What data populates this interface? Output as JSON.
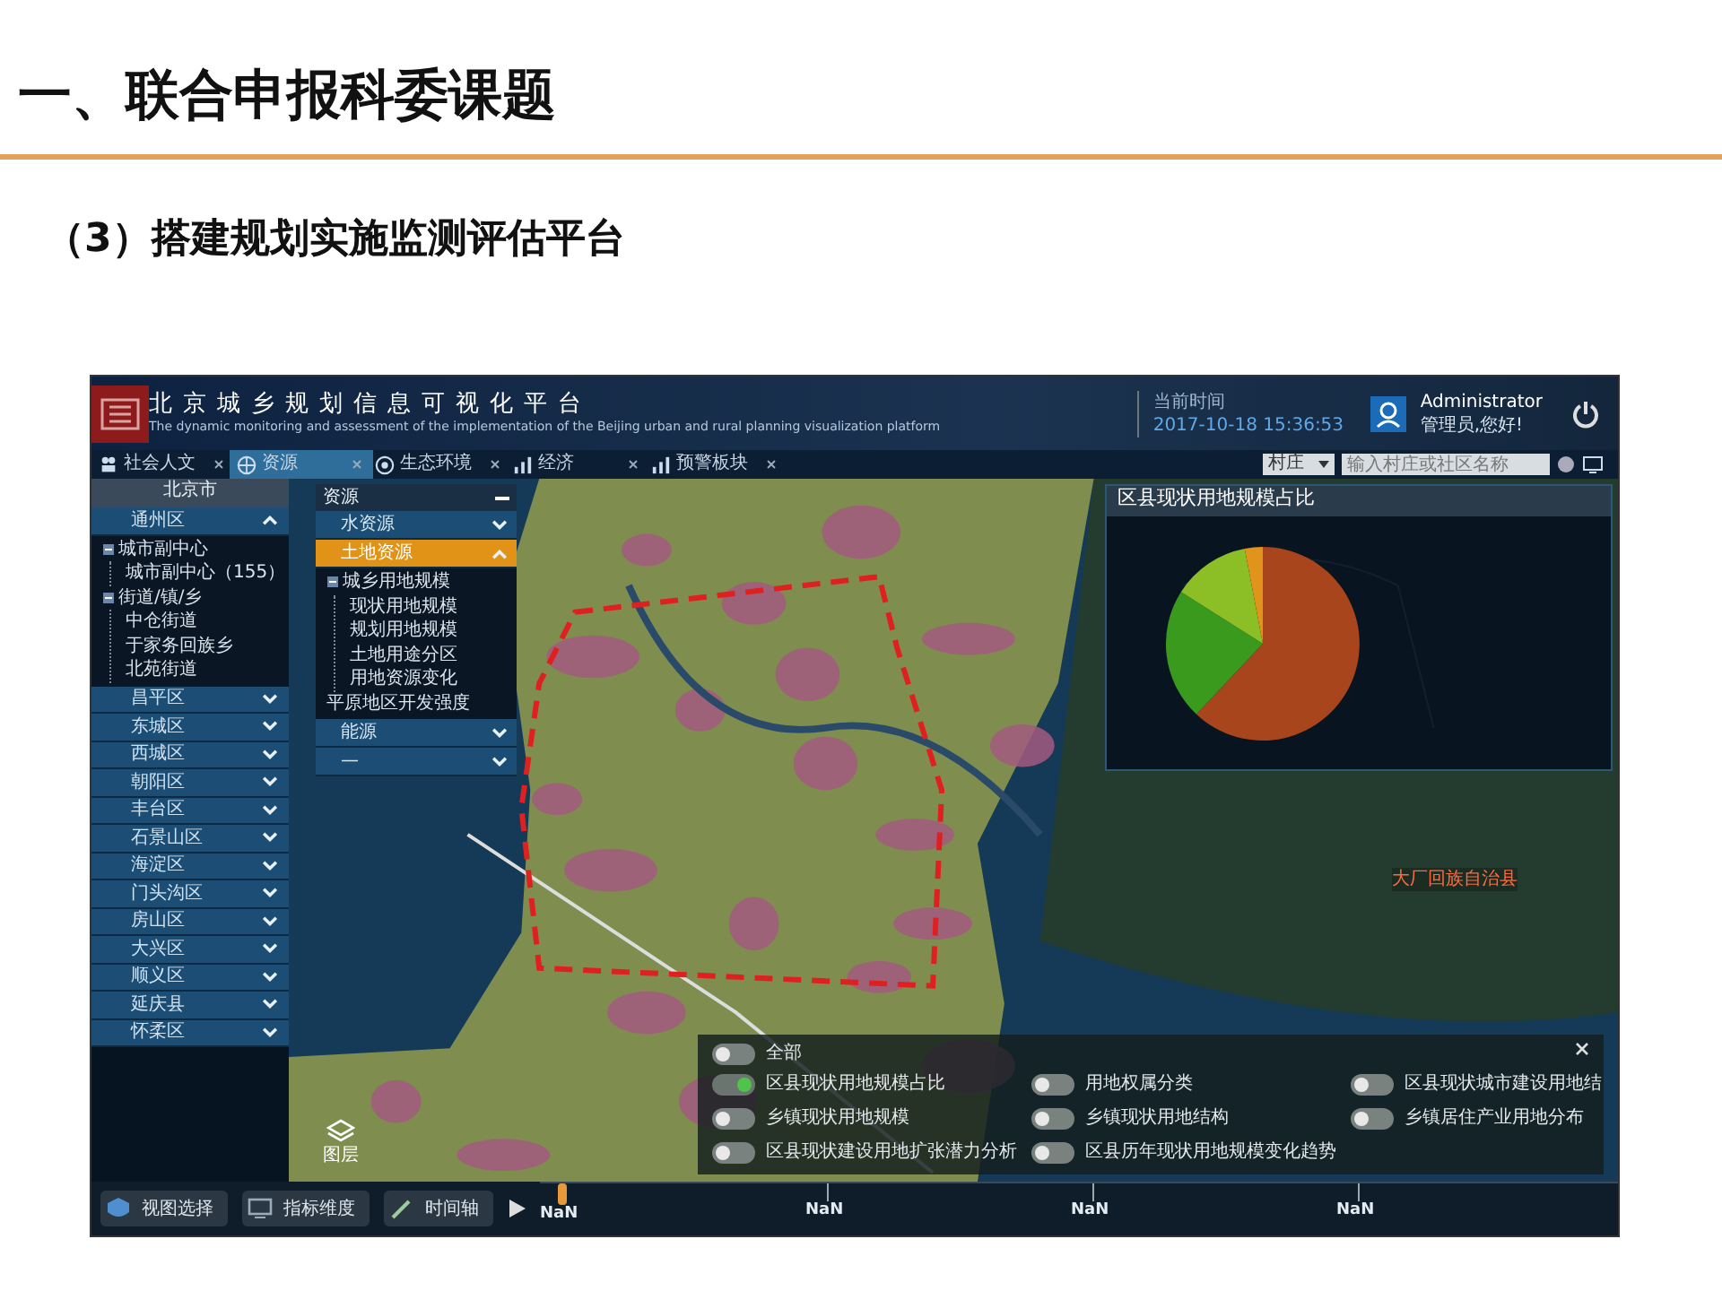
{
  "slide": {
    "title": "一、联合申报科委课题",
    "subtitle": "（3）搭建规划实施监测评估平台"
  },
  "app": {
    "header": {
      "title": "北京城乡规划信息可视化平台",
      "subtitle": "The dynamic monitoring and assessment of the implementation of the Beijing urban and rural planning visualization platform",
      "time_label": "当前时间",
      "time": "2017-10-18 15:36:53",
      "user_name": "Administrator",
      "user_greeting": "管理员,您好!"
    },
    "tabs": [
      {
        "label": "社会人文",
        "selected": false
      },
      {
        "label": "资源",
        "selected": true
      },
      {
        "label": "生态环境",
        "selected": false
      },
      {
        "label": "经济",
        "selected": false
      },
      {
        "label": "预警板块",
        "selected": false
      }
    ],
    "search": {
      "dropdown": "村庄",
      "placeholder": "输入村庄或社区名称"
    },
    "sidebar": {
      "title": "北京市",
      "districts": [
        {
          "label": "通州区",
          "expanded": true,
          "children": [
            {
              "label": "城市副中心",
              "children": [
                {
                  "label": "城市副中心（155）"
                }
              ]
            },
            {
              "label": "街道/镇/乡",
              "children": [
                {
                  "label": "中仓街道"
                },
                {
                  "label": "于家务回族乡"
                },
                {
                  "label": "北苑街道"
                }
              ]
            }
          ]
        },
        {
          "label": "昌平区",
          "expanded": false
        },
        {
          "label": "东城区",
          "expanded": false
        },
        {
          "label": "西城区",
          "expanded": false
        },
        {
          "label": "朝阳区",
          "expanded": false
        },
        {
          "label": "丰台区",
          "expanded": false
        },
        {
          "label": "石景山区",
          "expanded": false
        },
        {
          "label": "海淀区",
          "expanded": false
        },
        {
          "label": "门头沟区",
          "expanded": false
        },
        {
          "label": "房山区",
          "expanded": false
        },
        {
          "label": "大兴区",
          "expanded": false
        },
        {
          "label": "顺义区",
          "expanded": false
        },
        {
          "label": "延庆县",
          "expanded": false
        },
        {
          "label": "怀柔区",
          "expanded": false
        }
      ]
    },
    "resource_panel": {
      "title": "资源",
      "categories": [
        {
          "label": "水资源",
          "selected": false,
          "expanded": false
        },
        {
          "label": "土地资源",
          "selected": true,
          "expanded": true,
          "children": [
            {
              "label": "城乡用地规模",
              "children": [
                {
                  "label": "现状用地规模"
                },
                {
                  "label": "规划用地规模"
                },
                {
                  "label": "土地用途分区"
                },
                {
                  "label": "用地资源变化"
                }
              ]
            },
            {
              "label": "平原地区开发强度"
            }
          ]
        },
        {
          "label": "能源",
          "selected": false,
          "expanded": false
        },
        {
          "label": "—",
          "selected": false,
          "expanded": false
        }
      ]
    },
    "chart_panel": {
      "title": "区县现状用地规模占比"
    },
    "map_labels": [
      "大厂回族自治县"
    ],
    "layers_button": "图层",
    "layer_panel": {
      "all": {
        "label": "全部",
        "on": false
      },
      "layers": [
        {
          "label": "区县现状用地规模占比",
          "on": true
        },
        {
          "label": "用地权属分类",
          "on": false
        },
        {
          "label": "区县现状城市建设用地结",
          "on": false
        },
        {
          "label": "乡镇现状用地规模",
          "on": false
        },
        {
          "label": "乡镇现状用地结构",
          "on": false
        },
        {
          "label": "乡镇居住产业用地分布",
          "on": false
        },
        {
          "label": "区县现状建设用地扩张潜力分析",
          "on": false
        },
        {
          "label": "区县历年现状用地规模变化趋势",
          "on": false
        }
      ]
    },
    "toolbar": {
      "buttons": [
        "视图选择",
        "指标维度",
        "时间轴"
      ],
      "timeline_ticks": [
        "NaN",
        "NaN",
        "NaN",
        "NaN"
      ]
    }
  }
}
